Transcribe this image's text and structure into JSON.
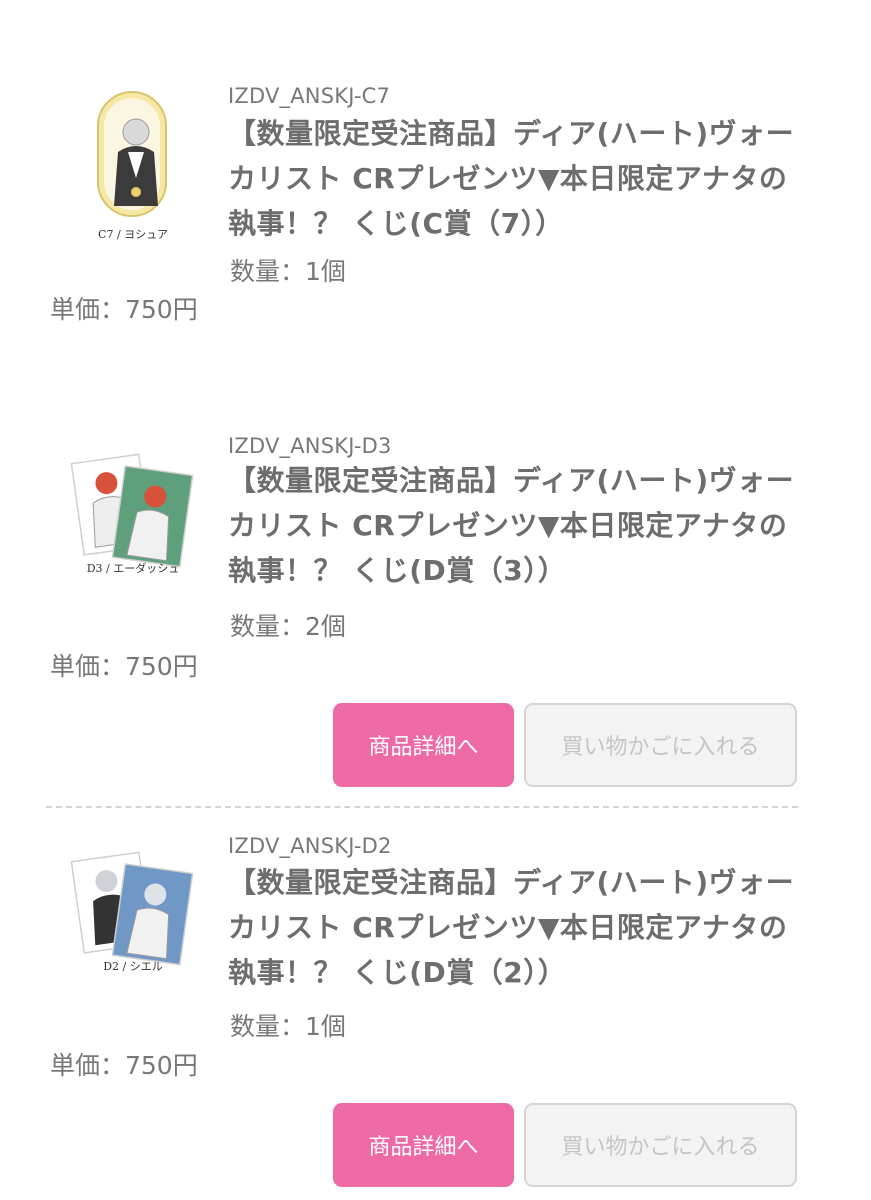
{
  "items": [
    {
      "sku": "IZDV_ANSKJ-C7",
      "title_lines": [
        "【数量限定受注商品】ディア(ハート)ヴォー",
        "カリスト CRプレゼンツ▼本日限定アナタの",
        "執事！？ くじ(C賞（7））"
      ],
      "quantity": "数量：1個",
      "price": "単価：750円",
      "image_caption": "C7 / ヨシュア"
    },
    {
      "sku": "IZDV_ANSKJ-D3",
      "title_lines": [
        "【数量限定受注商品】ディア(ハート)ヴォー",
        "カリスト CRプレゼンツ▼本日限定アナタの",
        "執事！？ くじ(D賞（3））"
      ],
      "quantity": "数量：2個",
      "price": "単価：750円",
      "image_caption": "D3 / エーダッシュ",
      "detail_button": "商品詳細へ",
      "cart_button": "買い物かごに入れる"
    },
    {
      "sku": "IZDV_ANSKJ-D2",
      "title_lines": [
        "【数量限定受注商品】ディア(ハート)ヴォー",
        "カリスト CRプレゼンツ▼本日限定アナタの",
        "執事！？ くじ(D賞（2））"
      ],
      "quantity": "数量：1個",
      "price": "単価：750円",
      "image_caption": "D2 / シエル",
      "detail_button": "商品詳細へ",
      "cart_button": "買い物かごに入れる"
    }
  ],
  "colors": {
    "accent_pink": "#ee6aa4",
    "disabled_gray": "#f3f3f3",
    "text_gray": "#6d6d6d"
  }
}
